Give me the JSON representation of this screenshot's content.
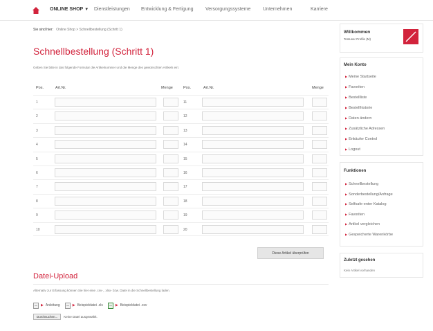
{
  "nav": {
    "items": [
      "ONLINE SHOP",
      "Dienstleistungen",
      "Entwicklung & Fertigung",
      "Versorgungssysteme",
      "Unternehmen",
      "Karriere"
    ]
  },
  "breadcrumb": {
    "here": "Sie sind hier:",
    "path": "Online Shop  >  Schnellbestellung (Schritt 1)"
  },
  "main": {
    "title": "Schnellbestellung (Schritt 1)",
    "intro": "Geben Sie bitte in das folgende Formular die Artikelnummer und die Menge des gewünschten Artikels ein:",
    "headers": {
      "pos": "Pos.",
      "article": "Art.Nr.",
      "qty": "Menge"
    },
    "left_positions": [
      "1",
      "2",
      "3",
      "4",
      "5",
      "6",
      "7",
      "8",
      "9",
      "10"
    ],
    "right_positions": [
      "11",
      "12",
      "13",
      "14",
      "15",
      "16",
      "17",
      "18",
      "19",
      "20"
    ],
    "check_button": "Diese Artikel überprüfen"
  },
  "upload": {
    "title": "Datei-Upload",
    "desc": "Alternativ zur Erfassung können Sie hier eine .csv-, .xlsx- bzw. Datei in die Schnellbestellung laden.",
    "links": [
      "Anleitung",
      "Beispieldatei .xls",
      "Beispieldatei .csv"
    ],
    "choose": "Durchsuchen...",
    "no_file": "Keine Datei ausgewählt."
  },
  "sidebar": {
    "welcome_title": "Willkommen",
    "welcome_sub": "Testuser Profile (M)",
    "konto_title": "Mein Konto",
    "konto_items": [
      "Meine Startseite",
      "Favoriten",
      "Bestellliste",
      "Bestellhistorie",
      "Daten ändern",
      "Zusätzliche Adressen",
      "Enkäufer Control",
      "Logout"
    ],
    "funk_title": "Funktionen",
    "funk_items": [
      "Schnellbestellung",
      "Sonderbestellung/Anfrage",
      "Selfsafe-enter Katalog",
      "Favoriten",
      "Artikel vergleichen",
      "Gespeicherte Warenkörbe"
    ],
    "recent_title": "Zuletzt gesehen",
    "recent_text": "Kein Artikel vorhanden"
  },
  "colors": {
    "accent": "#d2233c"
  }
}
